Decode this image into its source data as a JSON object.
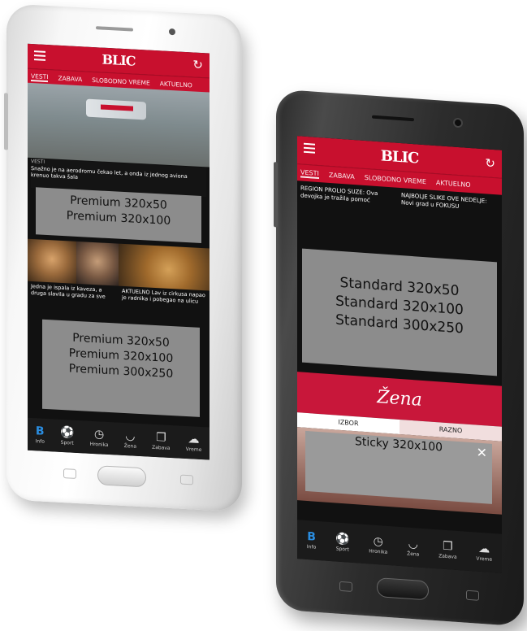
{
  "left_phone": {
    "logo": "BLIC",
    "tabs": [
      "VESTI",
      "ZABAVA",
      "SLOBODNO VREME",
      "AKTUELNO"
    ],
    "hero_caption_tag": "VESTI",
    "hero_caption": "Snažno je na aerodromu čekao let, a onda iz jednog aviona krenuo takva šala",
    "premium_top": [
      "Premium 320x50",
      "Premium 320x100"
    ],
    "card_left_text": "Jedna je ispala iz kaveza, a druga slavila u gradu za sve",
    "card_right_text": "AKTUELNO Lav iz cirkusa napao je radnika i pobegao na ulicu",
    "premium_bottom": [
      "Premium 320x50",
      "Premium 320x100",
      "Premium 300x250"
    ],
    "nav": [
      "Info",
      "Sport",
      "Hronika",
      "Žena",
      "Zabava",
      "Vreme"
    ]
  },
  "right_phone": {
    "logo": "BLIC",
    "tabs": [
      "VESTI",
      "ZABAVA",
      "SLOBODNO VREME",
      "AKTUELNO"
    ],
    "news_left": "REGION PROLIO SUZE: Ova devojka je tražila pomoć",
    "news_right": "NAJBOLJE SLIKE OVE NEDELJE: Novi grad u FOKUSU",
    "standard": [
      "Standard 320x50",
      "Standard 320x100",
      "Standard 300x250"
    ],
    "zena_logo": "Žena",
    "zena_tabs": [
      "IZBOR",
      "RAZNO"
    ],
    "sticky": "Sticky 320x100",
    "close_glyph": "✕",
    "nav": [
      "Info",
      "Sport",
      "Hronika",
      "Žena",
      "Zabava",
      "Vreme"
    ]
  }
}
